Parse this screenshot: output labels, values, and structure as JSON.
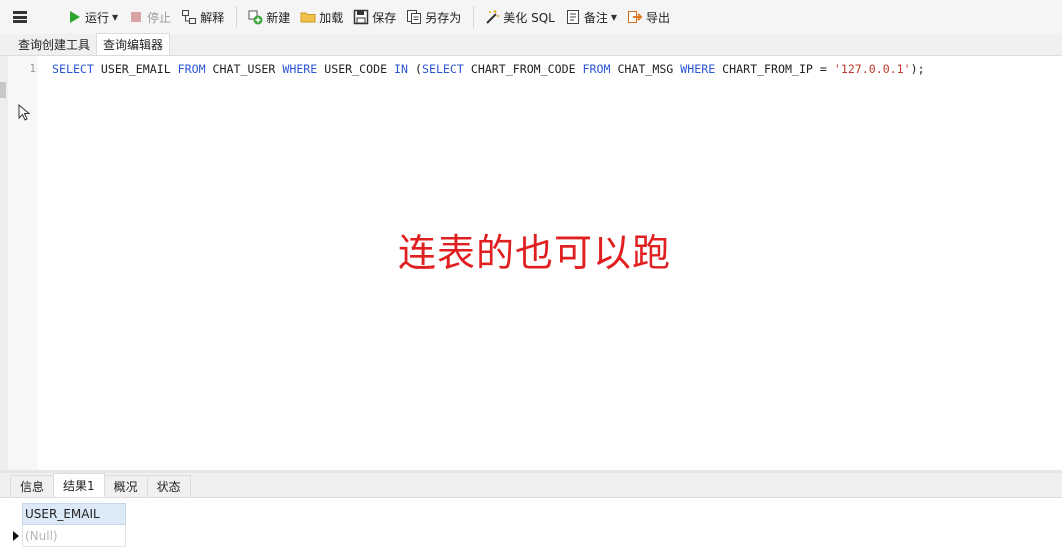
{
  "toolbar": {
    "run": "运行",
    "stop": "停止",
    "explain": "解释",
    "new": "新建",
    "load": "加载",
    "save": "保存",
    "save_as": "另存为",
    "beautify": "美化 SQL",
    "comment": "备注",
    "export": "导出"
  },
  "editor_tabs": [
    "查询创建工具",
    "查询编辑器"
  ],
  "editor": {
    "line_number": "1",
    "code_tokens": [
      {
        "t": "SELECT",
        "k": "kw"
      },
      {
        "t": " USER_EMAIL ",
        "k": ""
      },
      {
        "t": "FROM",
        "k": "kw"
      },
      {
        "t": " CHAT_USER ",
        "k": ""
      },
      {
        "t": "WHERE",
        "k": "kw"
      },
      {
        "t": " USER_CODE ",
        "k": ""
      },
      {
        "t": "IN",
        "k": "kw"
      },
      {
        "t": " (",
        "k": ""
      },
      {
        "t": "SELECT",
        "k": "kw"
      },
      {
        "t": " CHART_FROM_CODE ",
        "k": ""
      },
      {
        "t": "FROM",
        "k": "kw"
      },
      {
        "t": " CHAT_MSG ",
        "k": ""
      },
      {
        "t": "WHERE",
        "k": "kw"
      },
      {
        "t": " CHART_FROM_IP = ",
        "k": ""
      },
      {
        "t": "'127.0.0.1'",
        "k": "str"
      },
      {
        "t": ");",
        "k": ""
      }
    ],
    "annotation": "连表的也可以跑"
  },
  "result_tabs": [
    "信息",
    "结果1",
    "概况",
    "状态"
  ],
  "result_grid": {
    "column": "USER_EMAIL",
    "value": "(Null)"
  },
  "colors": {
    "keyword": "#2a55d6",
    "string": "#c0392b",
    "annotation": "#e02020",
    "run_icon": "#2fa52f"
  }
}
